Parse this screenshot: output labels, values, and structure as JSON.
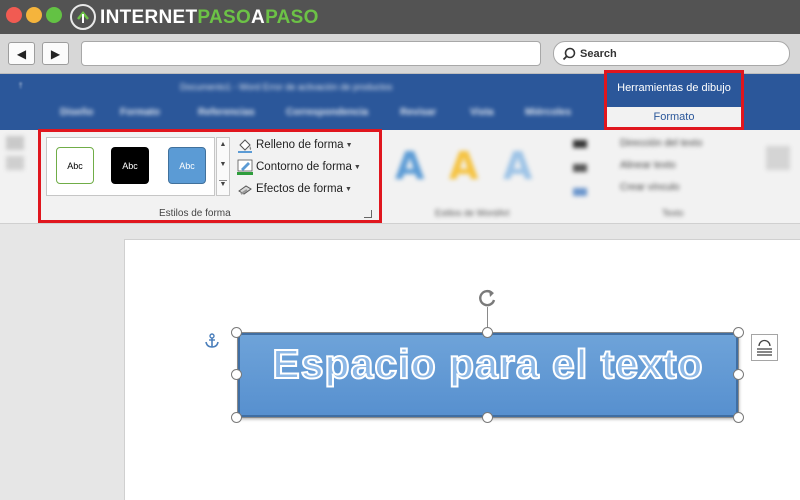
{
  "browser": {
    "logo": {
      "part1": "INTERNET",
      "part2": "PASO",
      "part3": "A",
      "part4": "PASO"
    },
    "search_placeholder": "Search",
    "nav": {
      "back": "◀",
      "forward": "▶"
    }
  },
  "word": {
    "title_blurred": "Documento1 - Word Error de activación de productos",
    "tabs_blurred": [
      "Diseño",
      "Formato",
      "Referencias",
      "Correspondencia",
      "Revisar",
      "Vista",
      "Miércoles"
    ],
    "tools": {
      "title": "Herramientas de dibujo",
      "tab": "Formato"
    }
  },
  "ribbon": {
    "styles": [
      "Abc",
      "Abc",
      "Abc"
    ],
    "fill_label": "Relleno de forma",
    "outline_label": "Contorno de forma",
    "effects_label": "Efectos de forma",
    "group_label": "Estilos de forma",
    "blurred_group2": "Estilos de WordArt",
    "blurred_group3": "Texto",
    "blurred_items": [
      "Dirección del texto",
      "Alinear texto",
      "Crear vínculo"
    ],
    "wordart_letters": [
      "A",
      "A",
      "A"
    ]
  },
  "document": {
    "shape_text": "Espacio para el texto"
  },
  "colors": {
    "word_blue": "#2b579a",
    "highlight_red": "#e0161e",
    "shape_fill": "#5b9bd5",
    "logo_green": "#6cc246"
  }
}
